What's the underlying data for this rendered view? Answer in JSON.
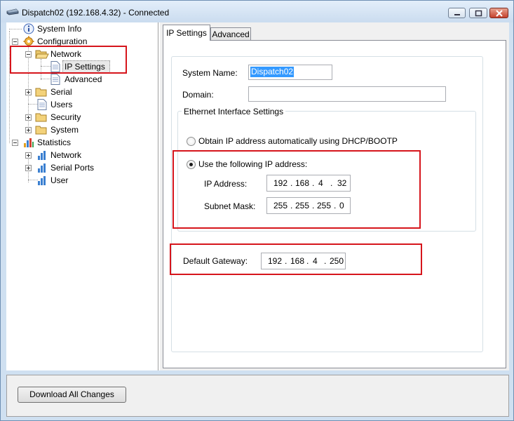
{
  "window": {
    "title": "Dispatch02 (192.168.4.32) - Connected"
  },
  "tree": {
    "system_info": "System Info",
    "configuration": "Configuration",
    "network": "Network",
    "ip_settings": "IP Settings",
    "advanced": "Advanced",
    "serial": "Serial",
    "users": "Users",
    "security": "Security",
    "system": "System",
    "statistics": "Statistics",
    "stat_network": "Network",
    "stat_serial_ports": "Serial Ports",
    "stat_user": "User"
  },
  "tabs": [
    "IP Settings",
    "Advanced"
  ],
  "form": {
    "system_name_label": "System Name:",
    "system_name_value": "Dispatch02",
    "domain_label": "Domain:",
    "domain_value": "",
    "ethernet_group_label": "Ethernet Interface Settings",
    "dhcp_option": "Obtain IP address automatically using DHCP/BOOTP",
    "static_option": "Use the following IP address:",
    "selected_option": "static",
    "ip_address_label": "IP Address:",
    "ip_address": [
      "192",
      "168",
      "4",
      "32"
    ],
    "subnet_mask_label": "Subnet Mask:",
    "subnet_mask": [
      "255",
      "255",
      "255",
      "0"
    ],
    "gateway_label": "Default Gateway:",
    "gateway": [
      "192",
      "168",
      "4",
      "250"
    ]
  },
  "footer": {
    "download_button": "Download All Changes"
  },
  "colors": {
    "highlight_box": "#d6151c",
    "selection": "#3399ff"
  }
}
